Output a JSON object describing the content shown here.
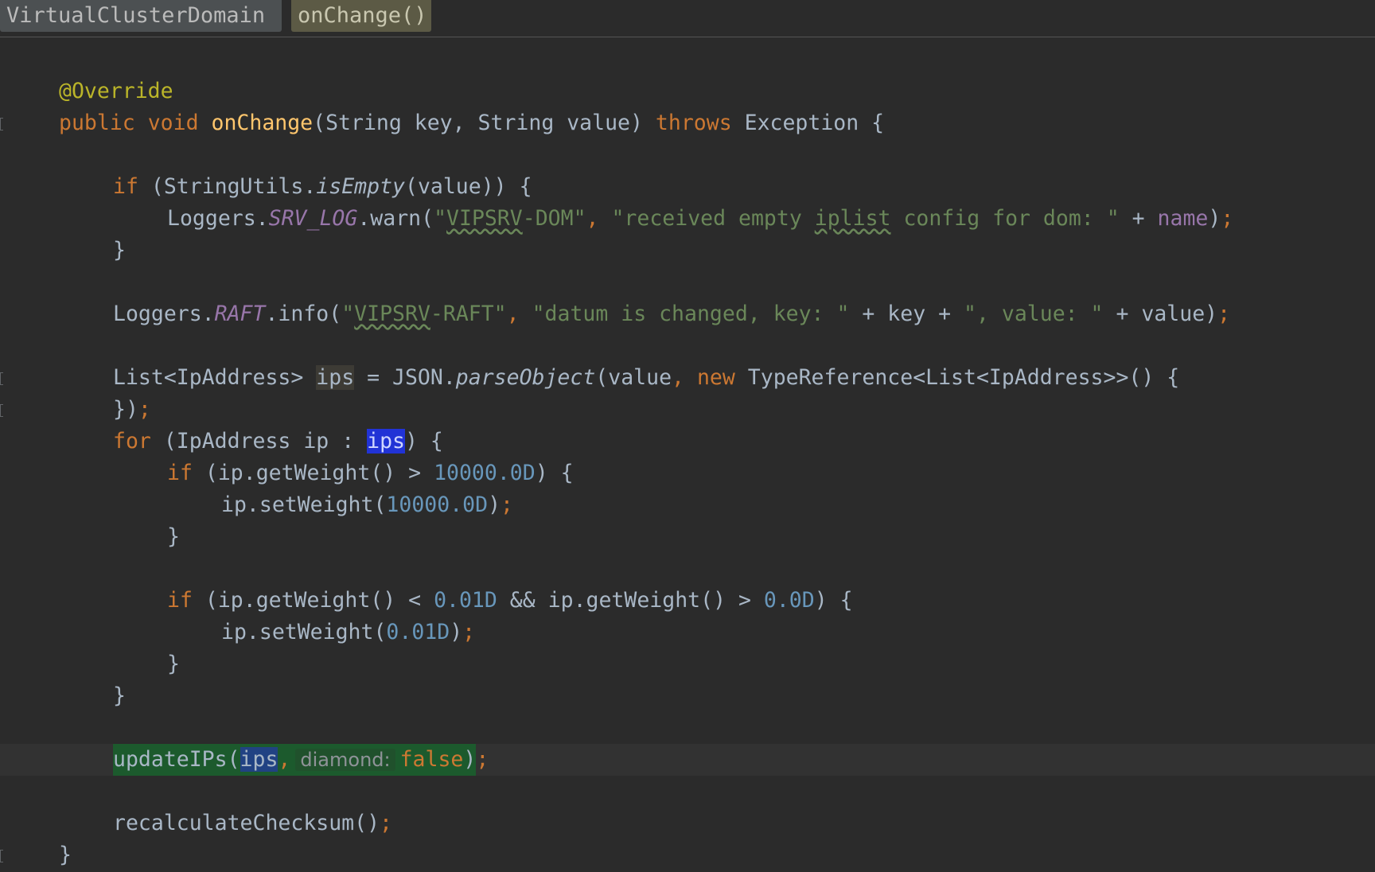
{
  "breadcrumb": {
    "class_name": "VirtualClusterDomain",
    "method_name": "onChange()"
  },
  "code": {
    "annotation": "@Override",
    "sig_public": "public",
    "sig_void": "void",
    "sig_name": "onChange",
    "sig_params": "(String key, String value) ",
    "sig_throws": "throws",
    "sig_tail": " Exception {",
    "if1_kw": "if",
    "if1_a": " (StringUtils.",
    "if1_method": "isEmpty",
    "if1_b": "(value)) {",
    "warn_a": "Loggers.",
    "warn_field": "SRV_LOG",
    "warn_b": ".warn(",
    "warn_str1_q": "\"",
    "warn_str1_typo": "VIPSRV",
    "warn_str1_rest": "-DOM\"",
    "warn_comma": ", ",
    "warn_str2_a": "\"received empty ",
    "warn_str2_typo": "iplist",
    "warn_str2_b": " config for dom: \"",
    "warn_plus": " + ",
    "warn_name": "name",
    "warn_close": ")",
    "semi": ";",
    "close_brace": "}",
    "info_a": "Loggers.",
    "info_field": "RAFT",
    "info_b": ".info(",
    "info_str1_q": "\"",
    "info_str1_typo": "VIPSRV",
    "info_str1_rest": "-RAFT\"",
    "info_comma": ", ",
    "info_str2": "\"datum is changed, key: \"",
    "info_plus1": " + key + ",
    "info_str3": "\", value: \"",
    "info_plus2": " + value)",
    "list_a": "List<IpAddress> ",
    "list_var": "ips",
    "list_b": " = JSON.",
    "list_method": "parseObject",
    "list_c": "(value",
    "list_comma": ", ",
    "list_new": "new",
    "list_d": " TypeReference<List<IpAddress>>() {",
    "list_close": "})",
    "for_kw": "for",
    "for_a": " (IpAddress ip : ",
    "for_var": "ips",
    "for_b": ") {",
    "if2_kw": "if",
    "if2_a": " (ip.getWeight() > ",
    "if2_num": "10000.0D",
    "if2_b": ") {",
    "set1_a": "ip.setWeight(",
    "set1_num": "10000.0D",
    "set1_b": ")",
    "if3_kw": "if",
    "if3_a": " (ip.getWeight() < ",
    "if3_num1": "0.01D",
    "if3_b": " && ip.getWeight() > ",
    "if3_num2": "0.0D",
    "if3_c": ") {",
    "set2_a": "ip.setWeight(",
    "set2_num": "0.01D",
    "set2_b": ")",
    "upd_a": "updateIPs(",
    "upd_var": "ips",
    "upd_comma": ",",
    "upd_hint": "diamond:",
    "upd_false": "false",
    "upd_b": ")",
    "recalc": "recalculateChecksum()"
  },
  "colors": {
    "background": "#2b2b2b",
    "keyword": "#cc7832",
    "string": "#6a8759",
    "number": "#6897bb",
    "function": "#ffc66d",
    "annotation": "#bbb529",
    "field": "#9876aa",
    "selection": "#2133d6"
  }
}
